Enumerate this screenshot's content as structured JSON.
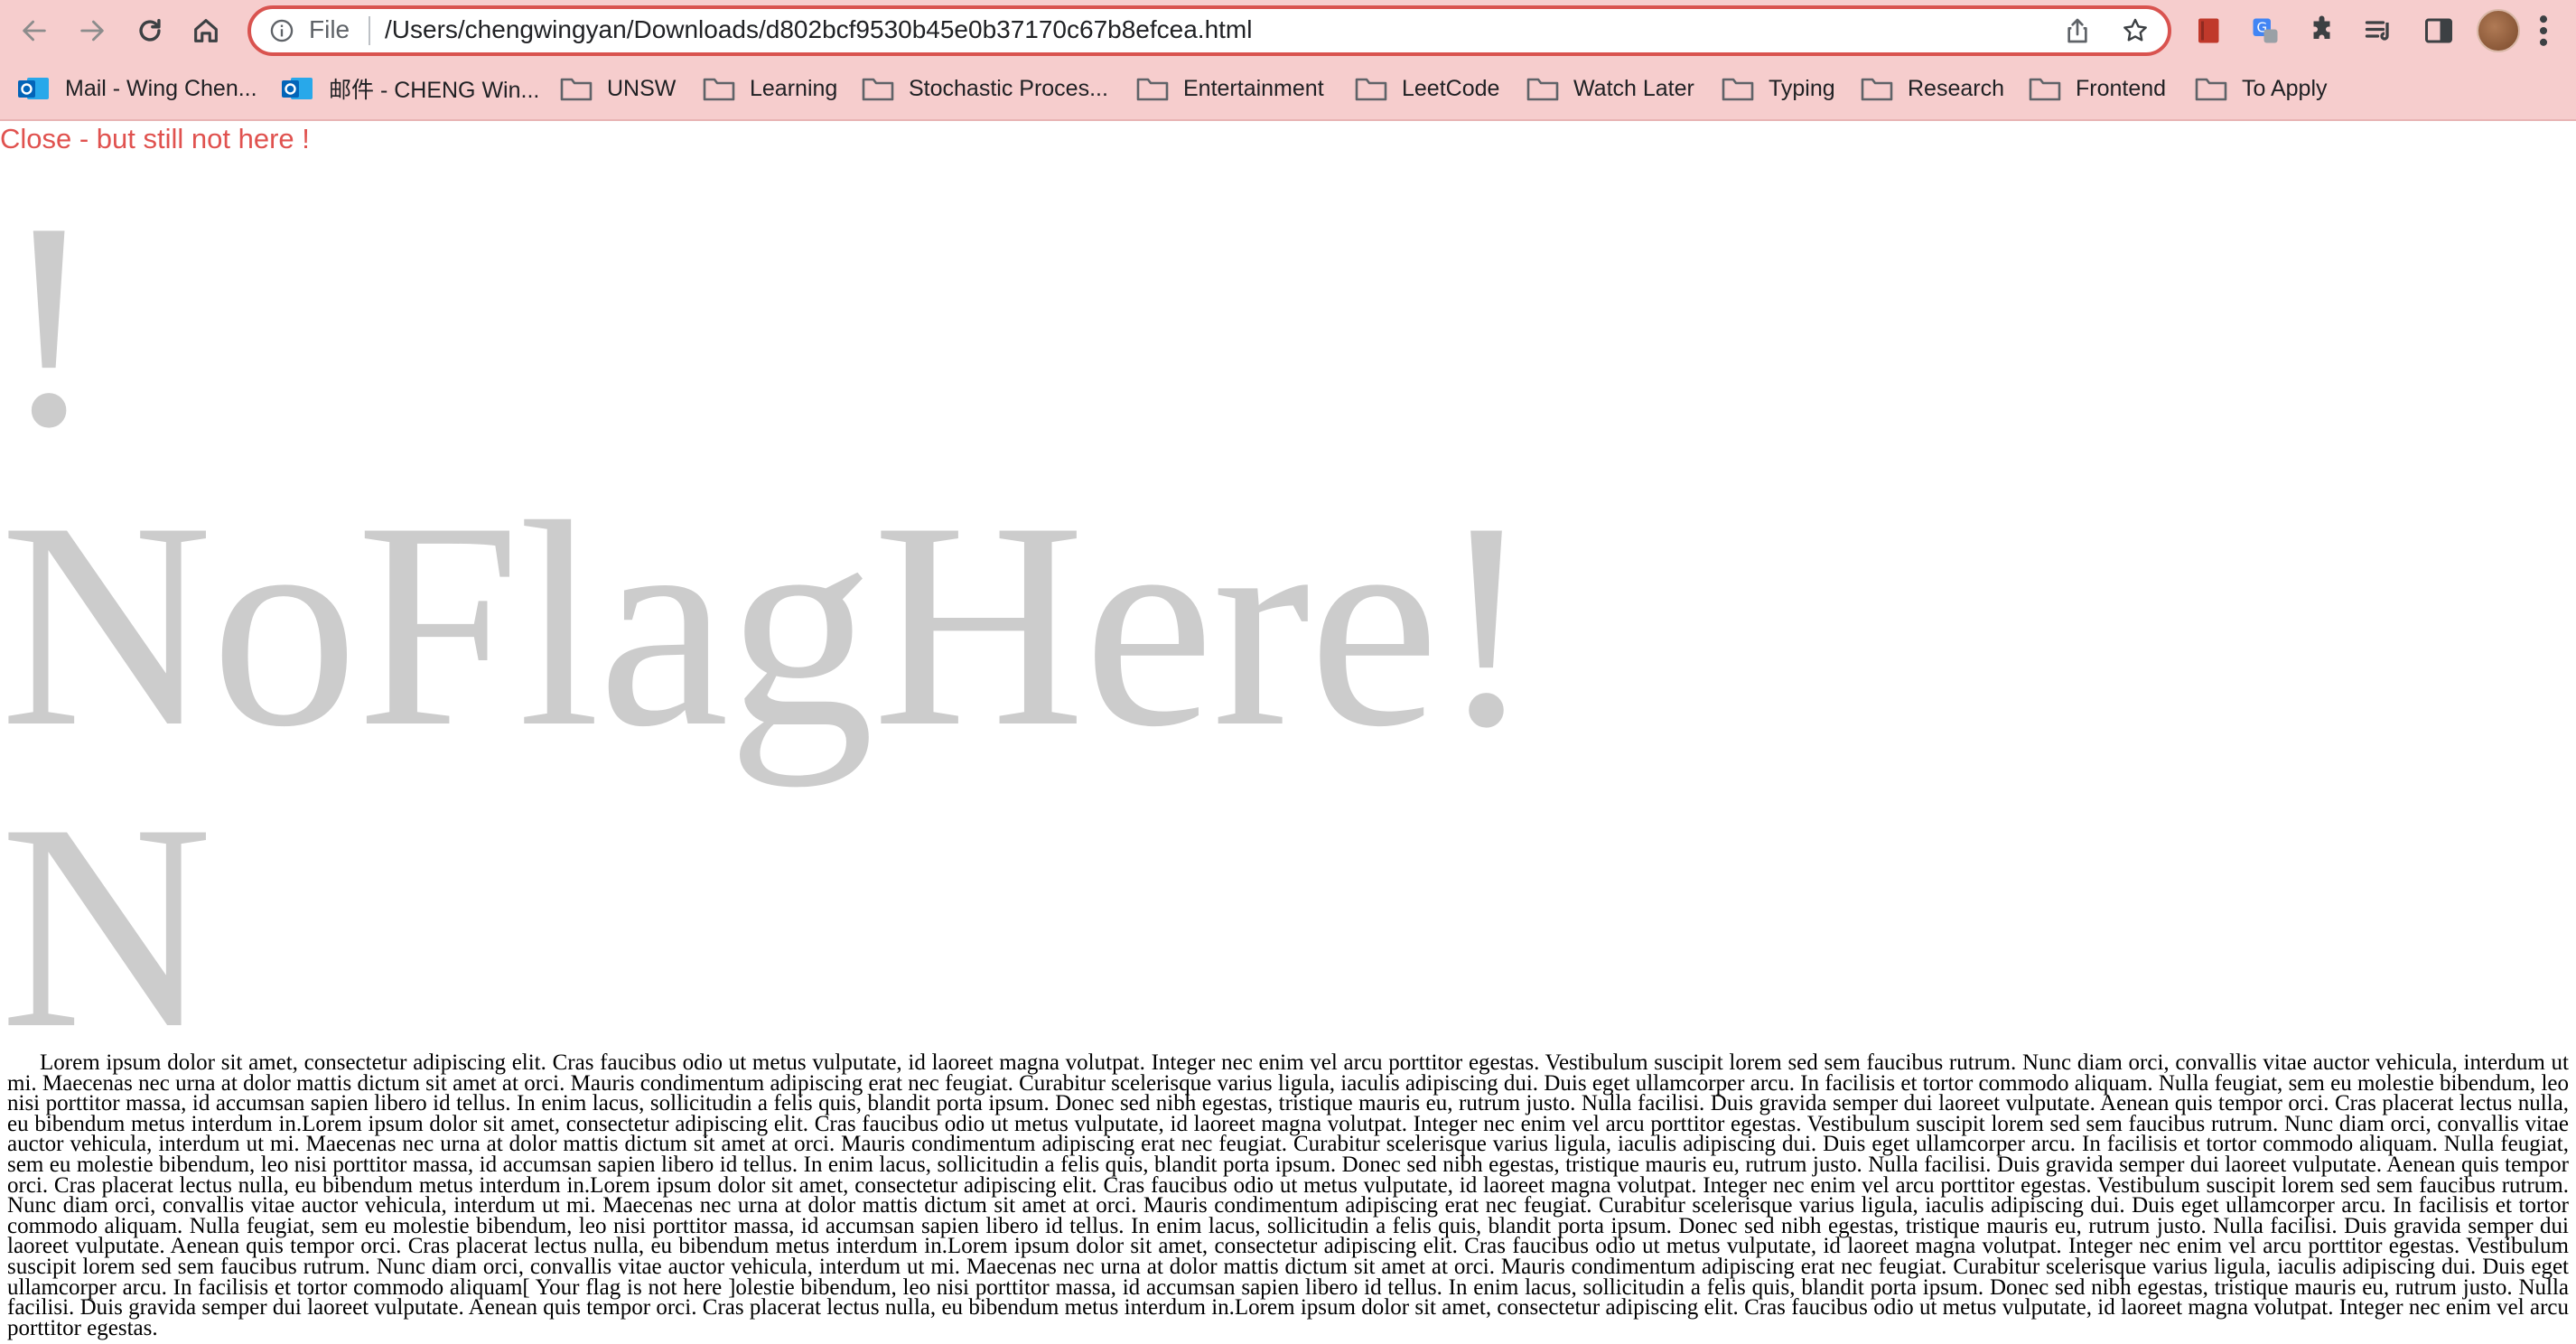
{
  "browser": {
    "scheme_label": "File",
    "url": "/Users/chengwingyan/Downloads/d802bcf9530b45e0b37170c67b8efcea.html",
    "theme_color": "#f6cdcd",
    "bookmarks": [
      {
        "label": "Mail - Wing Chen...",
        "icon": "outlook-icon"
      },
      {
        "label": "邮件 - CHENG Win...",
        "icon": "outlook-icon"
      },
      {
        "label": "UNSW",
        "icon": "folder-icon"
      },
      {
        "label": "Learning",
        "icon": "folder-icon"
      },
      {
        "label": "Stochastic Proces...",
        "icon": "folder-icon"
      },
      {
        "label": "Entertainment",
        "icon": "folder-icon"
      },
      {
        "label": "LeetCode",
        "icon": "folder-icon"
      },
      {
        "label": "Watch Later",
        "icon": "folder-icon"
      },
      {
        "label": "Typing",
        "icon": "folder-icon"
      },
      {
        "label": "Research",
        "icon": "folder-icon"
      },
      {
        "label": "Frontend",
        "icon": "folder-icon"
      },
      {
        "label": "To Apply",
        "icon": "folder-icon"
      }
    ]
  },
  "page": {
    "note": "Close - but still not here !",
    "note_color": "#e0524f",
    "big_lines": [
      "!",
      "NoFlagHere!",
      "N"
    ],
    "big_color": "#cccccc",
    "paragraph": "Lorem ipsum dolor sit amet, consectetur adipiscing elit. Cras faucibus odio ut metus vulputate, id laoreet magna volutpat. Integer nec enim vel arcu porttitor egestas. Vestibulum suscipit lorem sed sem faucibus rutrum. Nunc diam orci, convallis vitae auctor vehicula, interdum ut mi. Maecenas nec urna at dolor mattis dictum sit amet at orci. Mauris condimentum adipiscing erat nec feugiat. Curabitur scelerisque varius ligula, iaculis adipiscing dui. Duis eget ullamcorper arcu. In facilisis et tortor commodo aliquam. Nulla feugiat, sem eu molestie bibendum, leo nisi porttitor massa, id accumsan sapien libero id tellus. In enim lacus, sollicitudin a felis quis, blandit porta ipsum. Donec sed nibh egestas, tristique mauris eu, rutrum justo. Nulla facilisi. Duis gravida semper dui laoreet vulputate. Aenean quis tempor orci. Cras placerat lectus nulla, eu bibendum metus interdum in.Lorem ipsum dolor sit amet, consectetur adipiscing elit. Cras faucibus odio ut metus vulputate, id laoreet magna volutpat. Integer nec enim vel arcu porttitor egestas. Vestibulum suscipit lorem sed sem faucibus rutrum. Nunc diam orci, convallis vitae auctor vehicula, interdum ut mi. Maecenas nec urna at dolor mattis dictum sit amet at orci. Mauris condimentum adipiscing erat nec feugiat. Curabitur scelerisque varius ligula, iaculis adipiscing dui. Duis eget ullamcorper arcu. In facilisis et tortor commodo aliquam. Nulla feugiat, sem eu molestie bibendum, leo nisi porttitor massa, id accumsan sapien libero id tellus. In enim lacus, sollicitudin a felis quis, blandit porta ipsum. Donec sed nibh egestas, tristique mauris eu, rutrum justo. Nulla facilisi. Duis gravida semper dui laoreet vulputate. Aenean quis tempor orci. Cras placerat lectus nulla, eu bibendum metus interdum in.Lorem ipsum dolor sit amet, consectetur adipiscing elit. Cras faucibus odio ut metus vulputate, id laoreet magna volutpat. Integer nec enim vel arcu porttitor egestas. Vestibulum suscipit lorem sed sem faucibus rutrum. Nunc diam orci, convallis vitae auctor vehicula, interdum ut mi. Maecenas nec urna at dolor mattis dictum sit amet at orci. Mauris condimentum adipiscing erat nec feugiat. Curabitur scelerisque varius ligula, iaculis adipiscing dui. Duis eget ullamcorper arcu. In facilisis et tortor commodo aliquam. Nulla feugiat, sem eu molestie bibendum, leo nisi porttitor massa, id accumsan sapien libero id tellus. In enim lacus, sollicitudin a felis quis, blandit porta ipsum. Donec sed nibh egestas, tristique mauris eu, rutrum justo. Nulla facilisi. Duis gravida semper dui laoreet vulputate. Aenean quis tempor orci. Cras placerat lectus nulla, eu bibendum metus interdum in.Lorem ipsum dolor sit amet, consectetur adipiscing elit. Cras faucibus odio ut metus vulputate, id laoreet magna volutpat. Integer nec enim vel arcu porttitor egestas. Vestibulum suscipit lorem sed sem faucibus rutrum. Nunc diam orci, convallis vitae auctor vehicula, interdum ut mi. Maecenas nec urna at dolor mattis dictum sit amet at orci. Mauris condimentum adipiscing erat nec feugiat. Curabitur scelerisque varius ligula, iaculis adipiscing dui. Duis eget ullamcorper arcu. In facilisis et tortor commodo aliquam[ Your flag is not here ]olestie bibendum, leo nisi porttitor massa, id accumsan sapien libero id tellus. In enim lacus, sollicitudin a felis quis, blandit porta ipsum. Donec sed nibh egestas, tristique mauris eu, rutrum justo. Nulla facilisi. Duis gravida semper dui laoreet vulputate. Aenean quis tempor orci. Cras placerat lectus nulla, eu bibendum metus interdum in.Lorem ipsum dolor sit amet, consectetur adipiscing elit. Cras faucibus odio ut metus vulputate, id laoreet magna volutpat. Integer nec enim vel arcu porttitor egestas."
  }
}
